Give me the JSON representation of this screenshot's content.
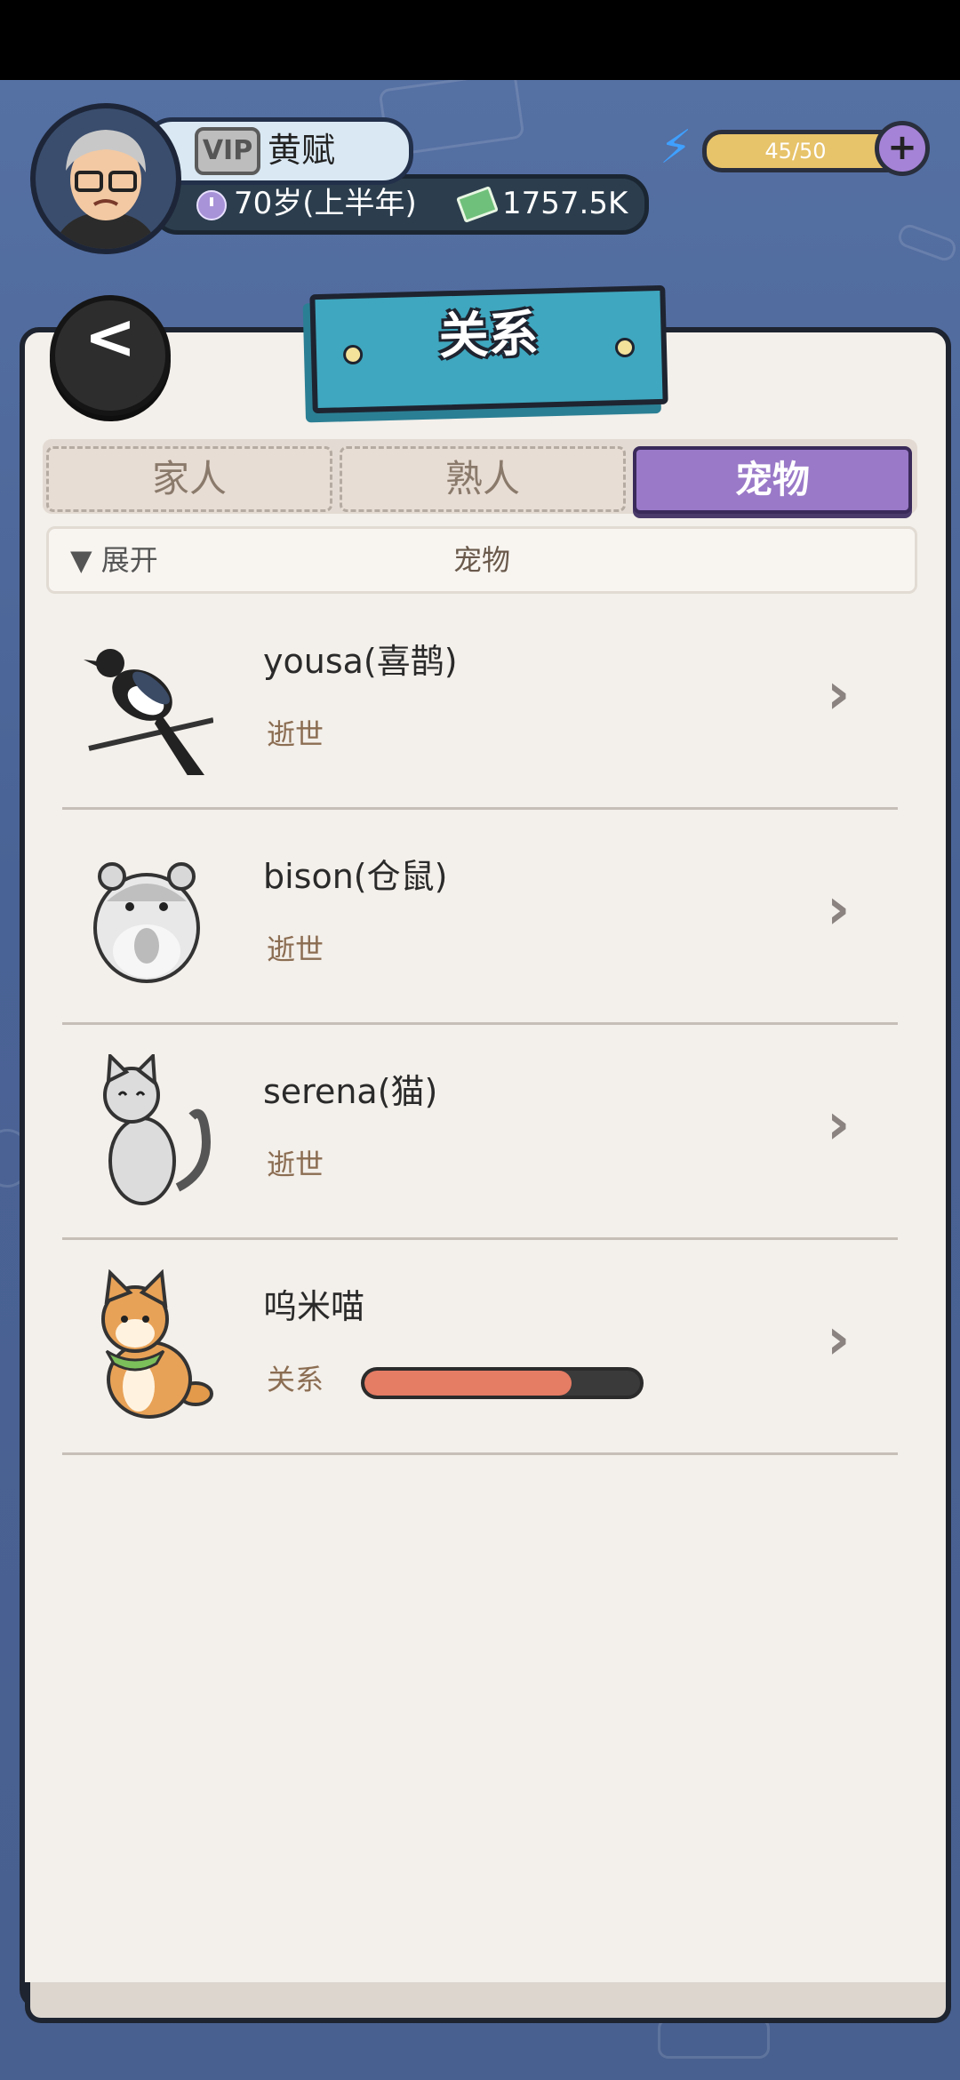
{
  "player": {
    "vip_label": "VIP",
    "name": "黄赋",
    "age": "70岁(上半年)",
    "money": "1757.5K"
  },
  "energy": {
    "text": "45/50",
    "add_label": "+"
  },
  "page": {
    "title": "关系",
    "back_label": "<"
  },
  "tabs": [
    {
      "label": "家人",
      "active": false
    },
    {
      "label": "熟人",
      "active": false
    },
    {
      "label": "宠物",
      "active": true
    }
  ],
  "filter": {
    "toggle": "▼ 展开",
    "label": "宠物"
  },
  "pets": [
    {
      "name": "yousa(喜鹊)",
      "status": "逝世",
      "icon": "magpie-icon"
    },
    {
      "name": "bison(仓鼠)",
      "status": "逝世",
      "icon": "hamster-icon"
    },
    {
      "name": "serena(猫)",
      "status": "逝世",
      "icon": "cat-icon"
    },
    {
      "name": "呜米喵",
      "status": "关系",
      "icon": "shiba-dog-icon",
      "relationship_level": 0.75
    }
  ],
  "colors": {
    "accent": "#9a79c8",
    "banner": "#3fa7bf",
    "relationship_fill": "#e57c64"
  }
}
